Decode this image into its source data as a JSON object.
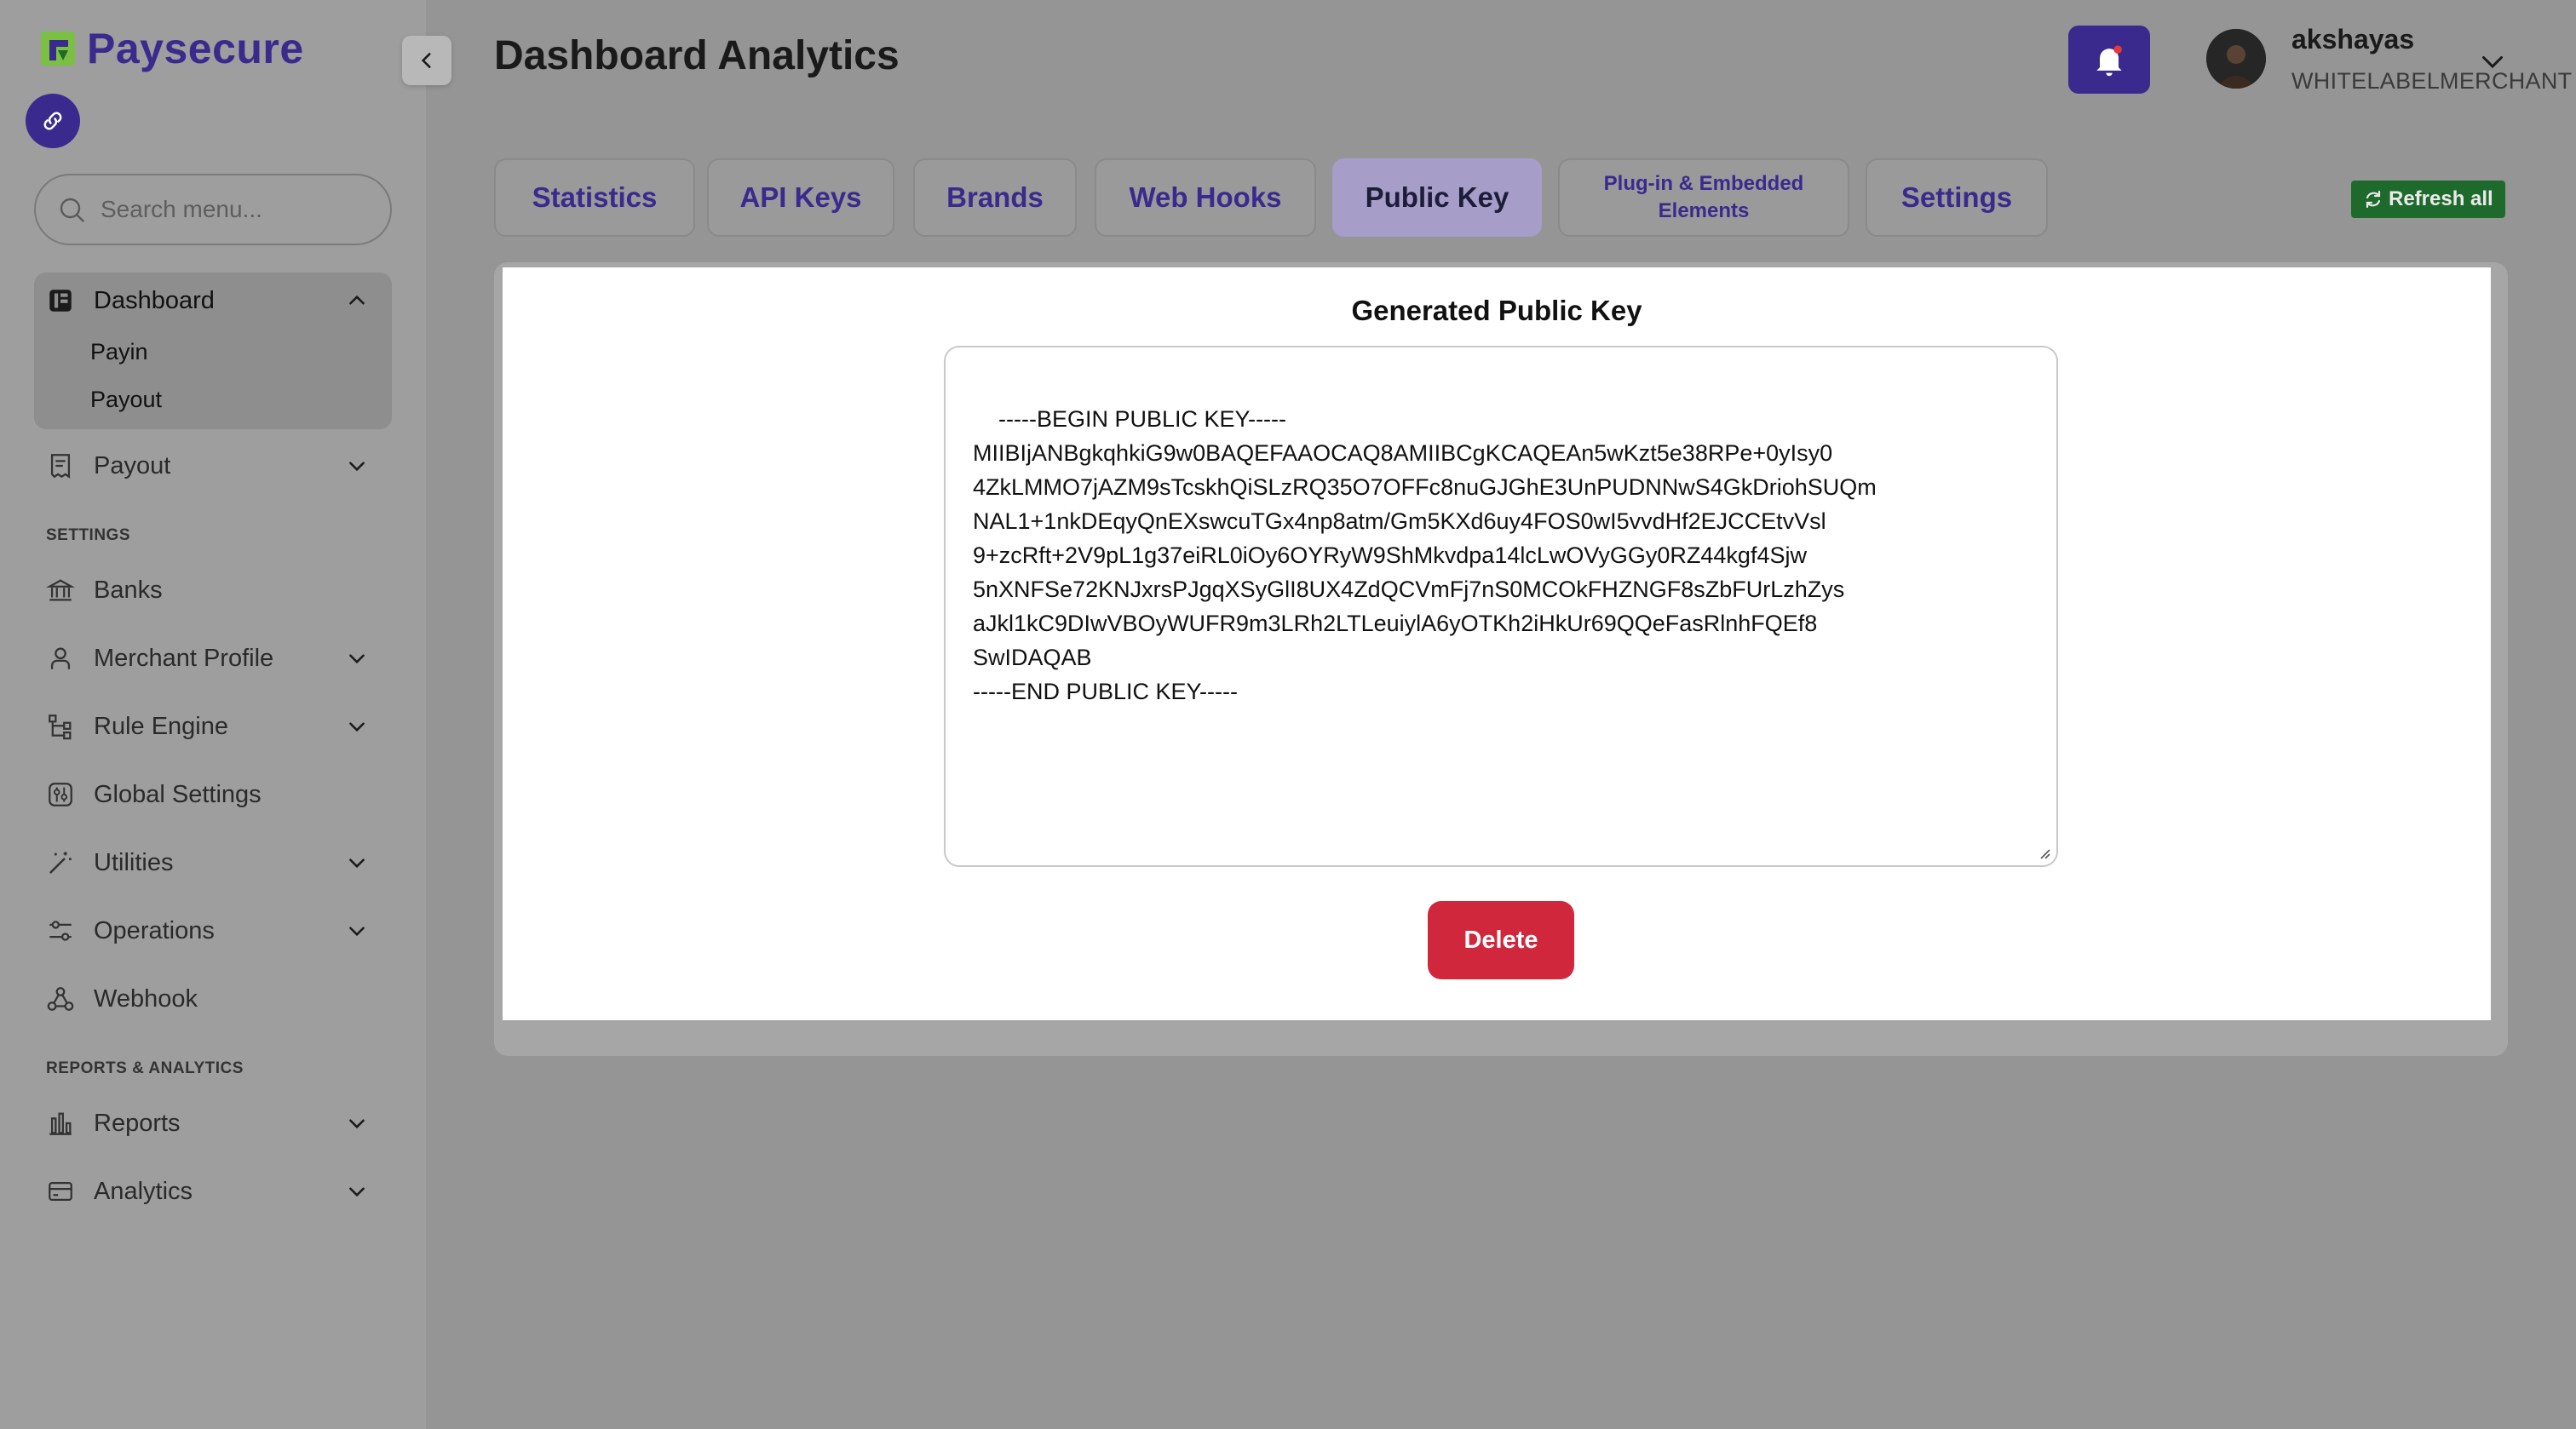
{
  "brand": {
    "name": "Paysecure",
    "accent": "#3b2a8e",
    "logo_green": "#7bc043"
  },
  "sidebar": {
    "search_placeholder": "Search menu...",
    "dashboard": {
      "label": "Dashboard",
      "children": [
        "Payin",
        "Payout"
      ]
    },
    "items_main": [
      {
        "label": "Payout",
        "icon": "receipt-icon",
        "expandable": true
      }
    ],
    "settings_label": "SETTINGS",
    "settings_items": [
      {
        "label": "Banks",
        "icon": "bank-icon",
        "expandable": false
      },
      {
        "label": "Merchant Profile",
        "icon": "user-icon",
        "expandable": true
      },
      {
        "label": "Rule Engine",
        "icon": "hierarchy-icon",
        "expandable": true
      },
      {
        "label": "Global Settings",
        "icon": "settings-grid-icon",
        "expandable": false
      },
      {
        "label": "Utilities",
        "icon": "magic-wand-icon",
        "expandable": true
      },
      {
        "label": "Operations",
        "icon": "sliders-icon",
        "expandable": true
      },
      {
        "label": "Webhook",
        "icon": "webhook-icon",
        "expandable": false
      }
    ],
    "reports_label": "REPORTS & ANALYTICS",
    "reports_items": [
      {
        "label": "Reports",
        "icon": "bar-chart-icon",
        "expandable": true
      },
      {
        "label": "Analytics",
        "icon": "credit-card-icon",
        "expandable": true
      }
    ]
  },
  "header": {
    "title": "Dashboard Analytics",
    "user": {
      "name": "akshayas",
      "role": "WHITELABELMERCHANT"
    }
  },
  "tabs": [
    {
      "label": "Statistics",
      "active": false
    },
    {
      "label": "API Keys",
      "active": false
    },
    {
      "label": "Brands",
      "active": false
    },
    {
      "label": "Web Hooks",
      "active": false
    },
    {
      "label": "Public Key",
      "active": true
    },
    {
      "label": "Plug-in & Embedded Elements",
      "active": false
    },
    {
      "label": "Settings",
      "active": false
    }
  ],
  "refresh_label": "Refresh all",
  "panel": {
    "title": "Generated Public Key",
    "key_text": "-----BEGIN PUBLIC KEY-----\nMIIBIjANBgkqhkiG9w0BAQEFAAOCAQ8AMIIBCgKCAQEAn5wKzt5e38RPe+0yIsy0\n4ZkLMMO7jAZM9sTcskhQiSLzRQ35O7OFFc8nuGJGhE3UnPUDNNwS4GkDriohSUQm\nNAL1+1nkDEqyQnEXswcuTGx4np8atm/Gm5KXd6uy4FOS0wI5vvdHf2EJCCEtvVsl\n9+zcRft+2V9pL1g37eiRL0iOy6OYRyW9ShMkvdpa14lcLwOVyGGy0RZ44kgf4Sjw\n5nXNFSe72KNJxrsPJgqXSyGlI8UX4ZdQCVmFj7nS0MCOkFHZNGF8sZbFUrLzhZys\naJkl1kC9DIwVBOyWUFR9m3LRh2LTLeuiylA6yOTKh2iHkUr69QQeFasRlnhFQEf8\nSwIDAQAB\n-----END PUBLIC KEY-----",
    "delete_label": "Delete"
  }
}
